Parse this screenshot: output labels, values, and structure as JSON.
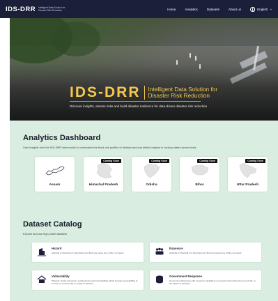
{
  "brand": {
    "name": "IDS-DRR",
    "tagline": "Intelligent Data Solution for Disaster Risk Reduction"
  },
  "nav": {
    "links": [
      "Home",
      "Analytics",
      "Datasets",
      "About us"
    ],
    "language": "English"
  },
  "hero": {
    "title": "IDS-DRR",
    "subtitle_line1": "Intelligent Data Solution for",
    "subtitle_line2": "Disaster Risk Reduction",
    "description": "Discover insights, assess risks and build disaster resilience for data-driven disaster risk reduction"
  },
  "analytics": {
    "title": "Analytics Dashboard",
    "subtitle": "Gain insights from the IDS-DRR data model to understand the flood-risk profiles of districts and sub-district regions in various states across India.",
    "coming_soon_label": "Coming Soon",
    "states": [
      {
        "name": "Assam",
        "coming_soon": false
      },
      {
        "name": "Himachal Pradesh",
        "coming_soon": true
      },
      {
        "name": "Odisha",
        "coming_soon": true
      },
      {
        "name": "Bihar",
        "coming_soon": true
      },
      {
        "name": "Uttar Pradesh",
        "coming_soon": true
      }
    ]
  },
  "catalog": {
    "title": "Dataset Catalog",
    "subtitle": "Explore and use high-value datasets",
    "datasets": [
      {
        "title": "Hazard",
        "description": "Hazards or Potential of a physical event that may cause loss of life or property",
        "icon": "hazard-icon"
      },
      {
        "title": "Exposure",
        "description": "Hazards or Potential of a physical event that may cause loss of life or property",
        "icon": "exposure-icon"
      },
      {
        "title": "Vulnerability",
        "description": "Physical, Social, Economic, and Environmental vulnerabilities which increase susceptibility of an area or a community to impact of hazards",
        "icon": "vulnerability-icon"
      },
      {
        "title": "Government Response",
        "description": "Government Response with respect to capacities or resources that reduce the level of risk, or the effects of disasters",
        "icon": "government-response-icon"
      }
    ]
  },
  "colors": {
    "nav_bg": "#1c1f3a",
    "accent": "#f5c84c",
    "content_bg": "#d9ede0"
  }
}
